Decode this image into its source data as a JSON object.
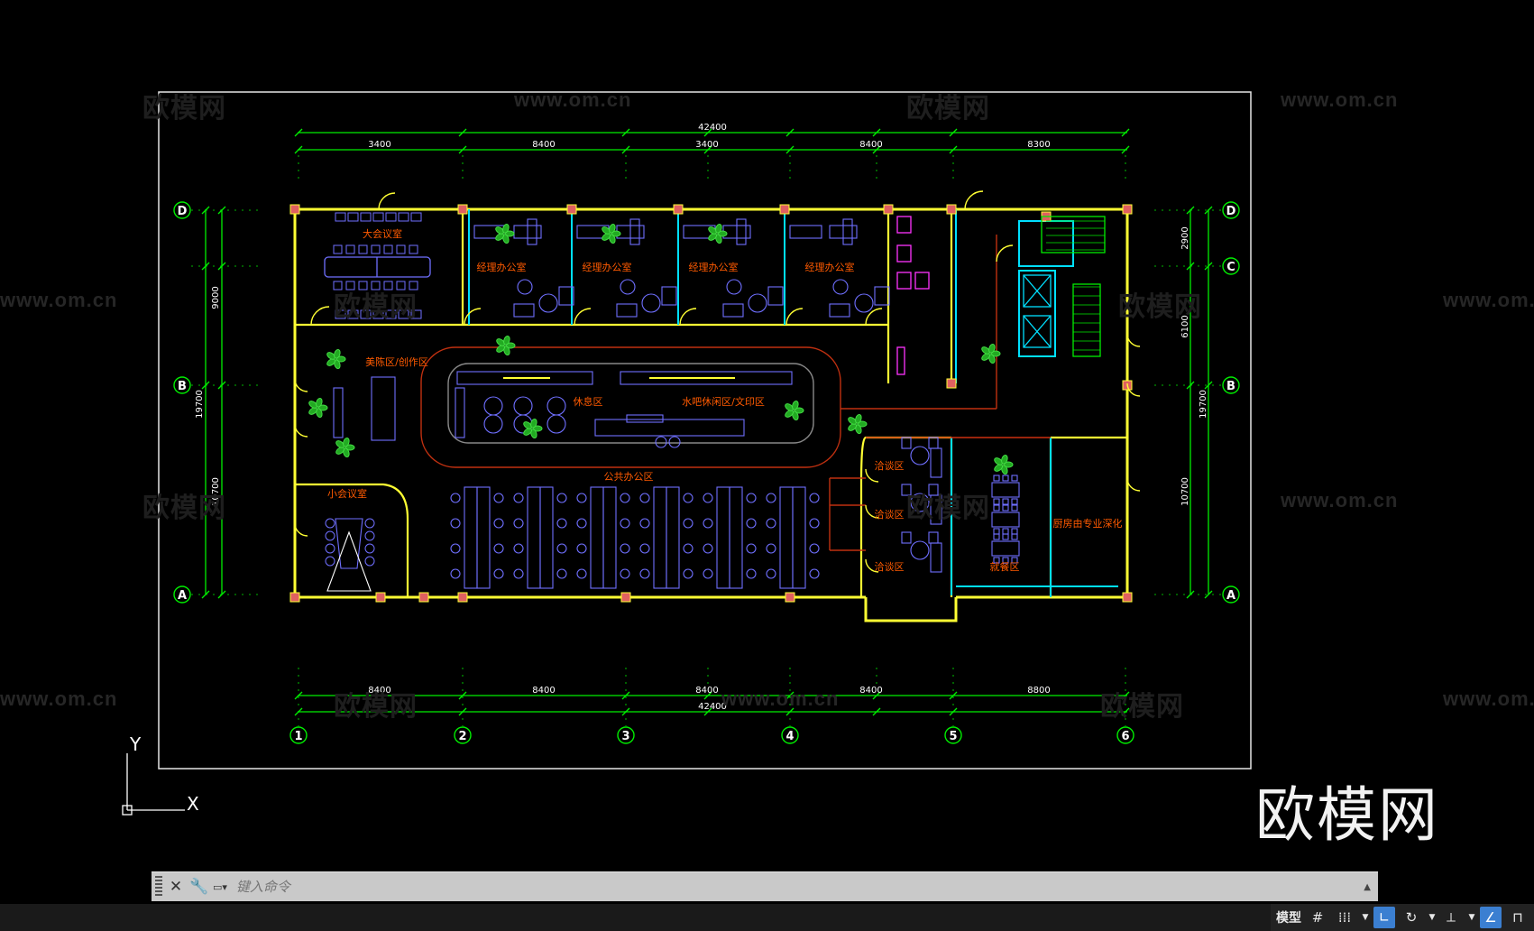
{
  "drawing": {
    "overall_dimension": "42400",
    "top_dimensions": [
      "3400",
      "8400",
      "3400",
      "8400",
      "8300"
    ],
    "bottom_dimensions": [
      "8400",
      "8400",
      "8400",
      "8400",
      "8800"
    ],
    "left_dimensions": [
      "9000",
      "19700",
      "10700"
    ],
    "right_dimensions": [
      "2900",
      "6100",
      "19700",
      "10700"
    ],
    "column_grid": [
      "1",
      "2",
      "3",
      "4",
      "5",
      "6"
    ],
    "row_grid": [
      "D",
      "C",
      "B",
      "A"
    ],
    "rooms": {
      "conference_large": "大会议室",
      "manager_office": "经理办公室",
      "display_area": "美陈区/创作区",
      "rest_area": "休息区",
      "bar_area": "水吧休闲区/文印区",
      "meeting_small": "小会议室",
      "open_office": "公共办公区",
      "negotiation": "洽谈区",
      "dining": "就餐区",
      "kitchen": "厨房由专业深化"
    },
    "axis_x": "X",
    "axis_y": "Y"
  },
  "watermarks": {
    "url": "www.om.cn",
    "brand_small": "欧模网"
  },
  "brand_logo": "欧模网",
  "command_line": {
    "placeholder": "键入命令"
  },
  "status_bar": {
    "model_tab": "模型"
  },
  "colors": {
    "wall": "#ffff33",
    "dimension": "#00ff00",
    "furniture": "#6f6fff",
    "text": "#ff5a00",
    "frame": "#ffffff",
    "cyan": "#00e0ff"
  }
}
